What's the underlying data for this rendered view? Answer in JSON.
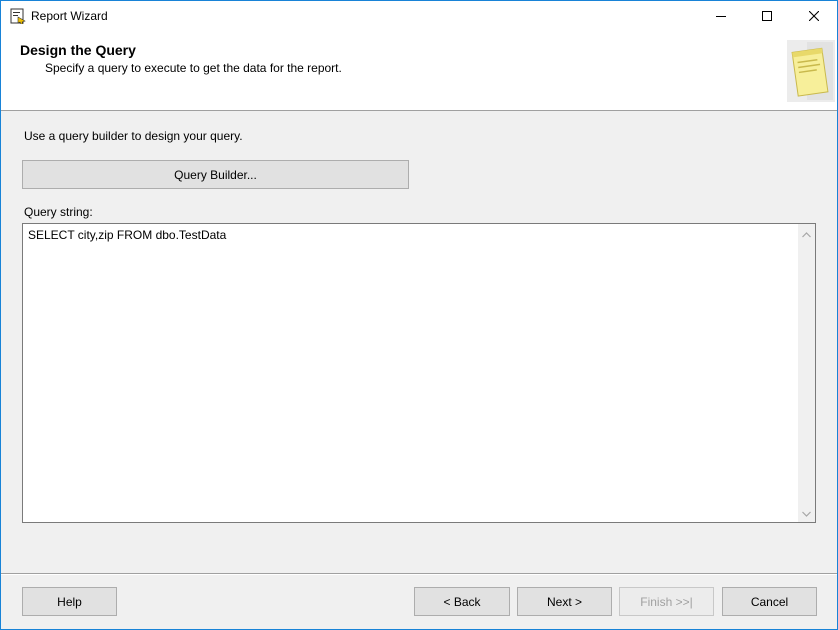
{
  "window": {
    "title": "Report Wizard"
  },
  "header": {
    "title": "Design the Query",
    "subtitle": "Specify a query to execute to get the data for the report."
  },
  "main": {
    "instruction": "Use a query builder to design your query.",
    "query_builder_label": "Query Builder...",
    "query_string_label": "Query string:",
    "query_text": "SELECT city,zip FROM dbo.TestData"
  },
  "footer": {
    "help_label": "Help",
    "back_label": "< Back",
    "next_label": "Next >",
    "finish_label": "Finish >>|",
    "cancel_label": "Cancel"
  },
  "icons": {
    "app": "report-wizard-icon",
    "minimize": "minimize-icon",
    "maximize": "maximize-icon",
    "close": "close-icon",
    "header_art": "notepad-icon",
    "scroll_up": "chevron-up-icon",
    "scroll_down": "chevron-down-icon"
  },
  "colors": {
    "window_border": "#1883d7",
    "background": "#f0f0f0",
    "button_face": "#e1e1e1",
    "disabled_text": "#a0a0a0"
  }
}
